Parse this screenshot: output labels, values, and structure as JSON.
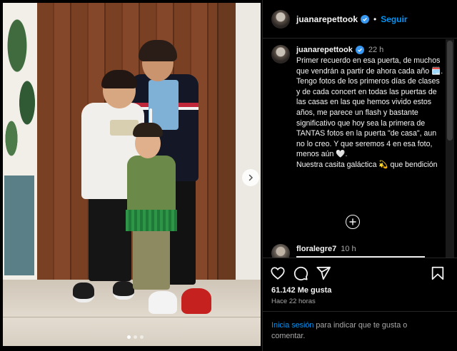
{
  "post": {
    "username": "juanarepettook",
    "follow_label": "Seguir",
    "separator": "•"
  },
  "caption": {
    "username": "juanarepettook",
    "time": "22 h",
    "text": "Primer recuerdo en esa puerta, de muchos que vendrán a partir de ahora cada año 🗓️.\nTengo fotos de los primeros días de clases y de cada concert en todas las puertas de las casas en las que hemos vivido estos años, me parece un flash y bastante significativo que hoy sea la primera de TANTAS fotos en la puerta \"de casa\", aun no lo creo. Y que seremos 4 en esa foto, menos aún 🤍.\nNuestra casita galáctica 💫 que bendición"
  },
  "comment": {
    "username": "floralegre7",
    "time": "10 h"
  },
  "stats": {
    "likes": "61.142 Me gusta",
    "ago": "Hace 22 horas"
  },
  "login": {
    "link": "Inicia sesión",
    "rest": " para indicar que te gusta o comentar."
  },
  "carousel": {
    "slide": 1,
    "total": 3
  },
  "icons": [
    "verified-badge-icon",
    "heart-icon",
    "comment-icon",
    "share-icon",
    "bookmark-icon",
    "plus-circle-icon",
    "chevron-right-icon"
  ],
  "colors": {
    "accent": "#0095f6",
    "verified": "#3897f0",
    "background": "#000000",
    "muted": "#a8a8a8"
  }
}
